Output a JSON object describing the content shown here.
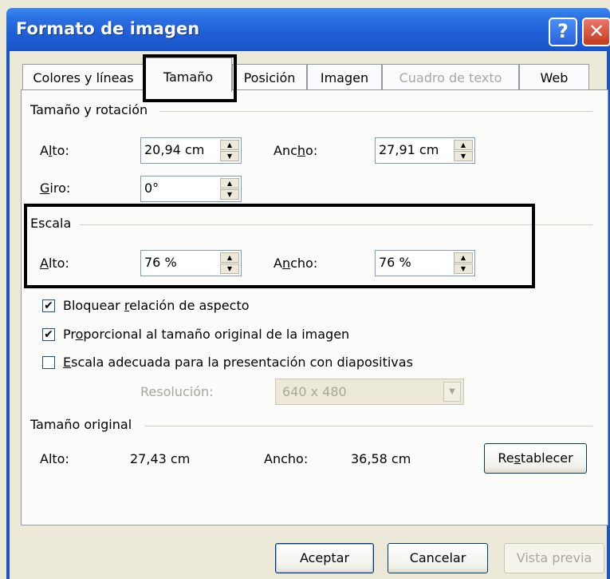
{
  "window": {
    "title": "Formato de imagen",
    "help_label": "?",
    "close_label": "✕"
  },
  "tabs": [
    {
      "label": "Colores y líneas"
    },
    {
      "label": "Tamaño"
    },
    {
      "label": "Posición"
    },
    {
      "label": "Imagen"
    },
    {
      "label": "Cuadro de texto"
    },
    {
      "label": "Web"
    }
  ],
  "size_rotation": {
    "title": "Tamaño y rotación",
    "height": {
      "label_a": "A",
      "label_u": "l",
      "label_b": "to:",
      "value": "20,94 cm"
    },
    "width": {
      "label_a": "Anc",
      "label_u": "h",
      "label_b": "o:",
      "value": "27,91 cm"
    },
    "rotation": {
      "label_u": "G",
      "label_b": "iro:",
      "value": "0°"
    }
  },
  "scale": {
    "title": "Escala",
    "height": {
      "label_u": "A",
      "label_b": "lto:",
      "value": "76 %"
    },
    "width": {
      "label_a": "A",
      "label_u": "n",
      "label_b": "cho:",
      "value": "76 %"
    },
    "lock_ratio": {
      "checked": true,
      "label_a": "Bloquear ",
      "label_u": "r",
      "label_b": "elación de aspecto"
    },
    "relative_original": {
      "checked": true,
      "label_a": "Pr",
      "label_u": "o",
      "label_b": "porcional al tamaño original de la imagen"
    },
    "best_scale": {
      "checked": false,
      "label_u": "E",
      "label_b": "scala adecuada para la presentación con diapositivas"
    },
    "resolution_label": "Resolución:",
    "resolution_value": "640 x 480"
  },
  "original_size": {
    "title": "Tamaño original",
    "height_label": "Alto:",
    "height_value": "27,43 cm",
    "width_label": "Ancho:",
    "width_value": "36,58 cm",
    "reset_a": "Re",
    "reset_u": "s",
    "reset_b": "tablecer"
  },
  "footer": {
    "ok_label": "Aceptar",
    "cancel_label": "Cancelar",
    "preview_label": "Vista previa"
  },
  "colors": {
    "titlebar": "#1f5fd6",
    "highlight": "#000000",
    "dialog": "#ece9d8"
  }
}
